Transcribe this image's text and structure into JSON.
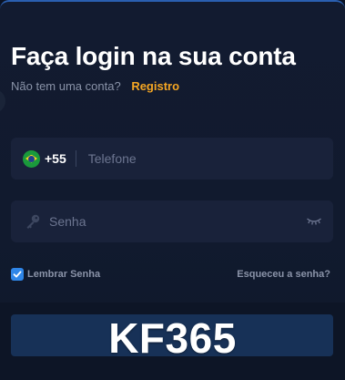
{
  "login": {
    "title": "Faça login na sua conta",
    "no_account_text": "Não tem uma conta?",
    "register_link": "Registro",
    "phone": {
      "country_flag": "brazil-flag",
      "country_code": "+55",
      "placeholder": "Telefone"
    },
    "password": {
      "placeholder": "Senha",
      "icon": "key-icon",
      "toggle_icon": "eye-closed-icon"
    },
    "remember_label": "Lembrar Senha",
    "remember_checked": true,
    "forgot_link": "Esqueceu a senha?"
  },
  "watermark": "KF365",
  "colors": {
    "background": "#111a2e",
    "field": "#19223a",
    "accent": "#f5a623",
    "checkbox": "#2f86e8",
    "button": "#173157"
  }
}
